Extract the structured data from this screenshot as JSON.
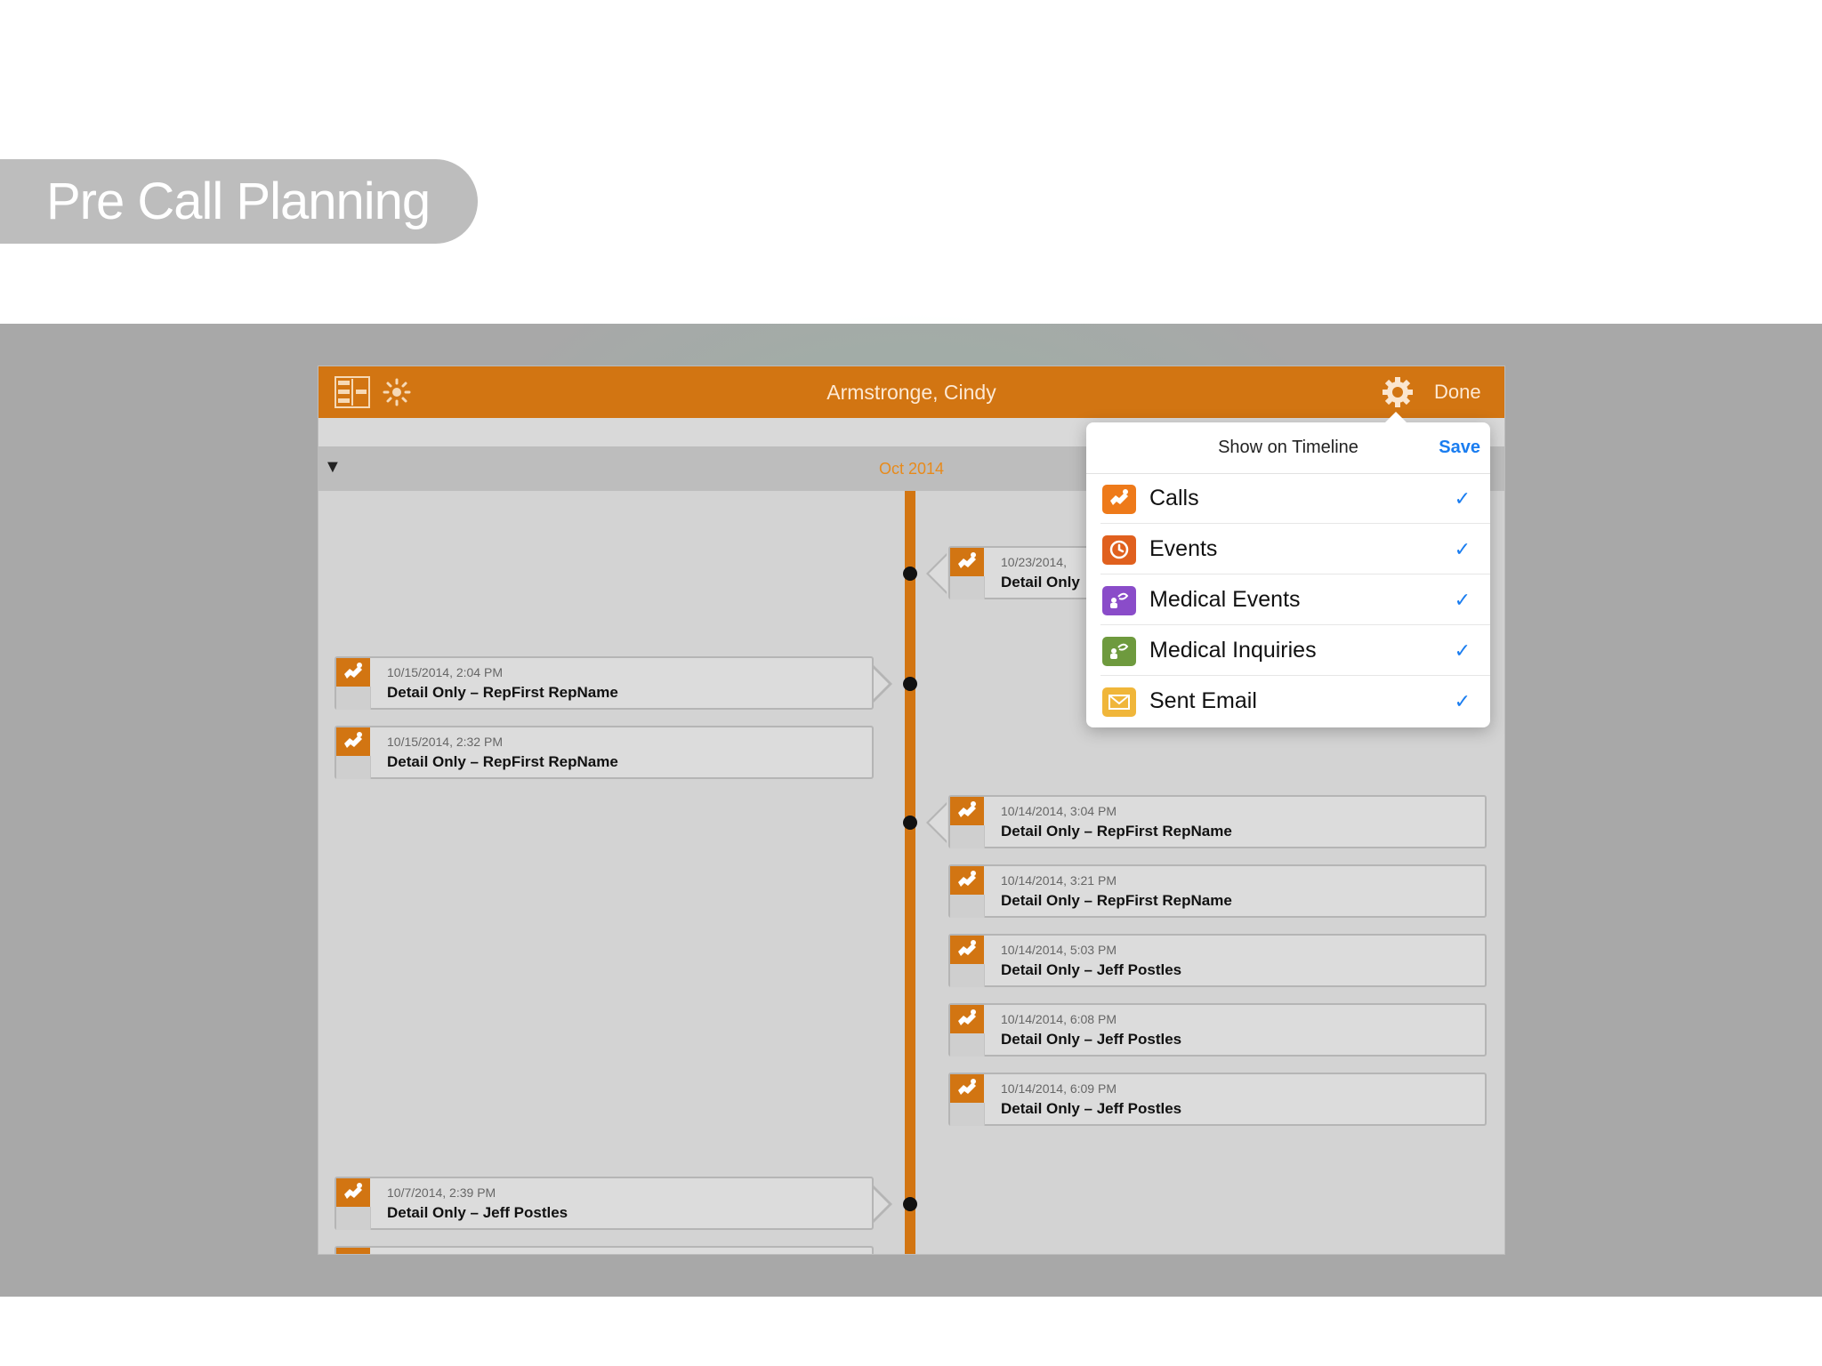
{
  "slide": {
    "section_title": "Pre Call Planning"
  },
  "navbar": {
    "title": "Armstronge, Cindy",
    "done_label": "Done",
    "left_icons": [
      "split-view-icon",
      "sun-icon"
    ],
    "settings_icon": "gear-icon"
  },
  "timeline": {
    "month": "Oct 2014",
    "collapse_glyph": "▼",
    "left_cards": [
      {
        "date": "10/15/2014, 2:04 PM",
        "title": "Detail Only – RepFirst RepName"
      },
      {
        "date": "10/15/2014, 2:32 PM",
        "title": "Detail Only – RepFirst RepName"
      },
      {
        "date": "10/7/2014, 2:39 PM",
        "title": "Detail Only – Jeff Postles"
      }
    ],
    "right_cards": [
      {
        "date": "10/23/2014, ",
        "title": "Detail Only"
      },
      {
        "date": "10/14/2014, 3:04 PM",
        "title": "Detail Only – RepFirst RepName"
      },
      {
        "date": "10/14/2014, 3:21 PM",
        "title": "Detail Only – RepFirst RepName"
      },
      {
        "date": "10/14/2014, 5:03 PM",
        "title": "Detail Only – Jeff Postles"
      },
      {
        "date": "10/14/2014, 6:08 PM",
        "title": "Detail Only – Jeff Postles"
      },
      {
        "date": "10/14/2014, 6:09 PM",
        "title": "Detail Only – Jeff Postles"
      }
    ]
  },
  "popover": {
    "title": "Show on Timeline",
    "save_label": "Save",
    "check_glyph": "✓",
    "rows": [
      {
        "label": "Calls",
        "icon": "calls-icon",
        "color": "#ee7a1a",
        "checked": true
      },
      {
        "label": "Events",
        "icon": "clock-icon",
        "color": "#e0601e",
        "checked": true
      },
      {
        "label": "Medical Events",
        "icon": "medical-events-icon",
        "color": "#8a4cc9",
        "checked": true
      },
      {
        "label": "Medical Inquiries",
        "icon": "medical-inquiries-icon",
        "color": "#6e9a3e",
        "checked": true
      },
      {
        "label": "Sent Email",
        "icon": "envelope-icon",
        "color": "#f0b63a",
        "checked": true
      }
    ]
  },
  "colors": {
    "accent": "#d27512",
    "month_label": "#e88a1a",
    "link_blue": "#1a7df0"
  }
}
